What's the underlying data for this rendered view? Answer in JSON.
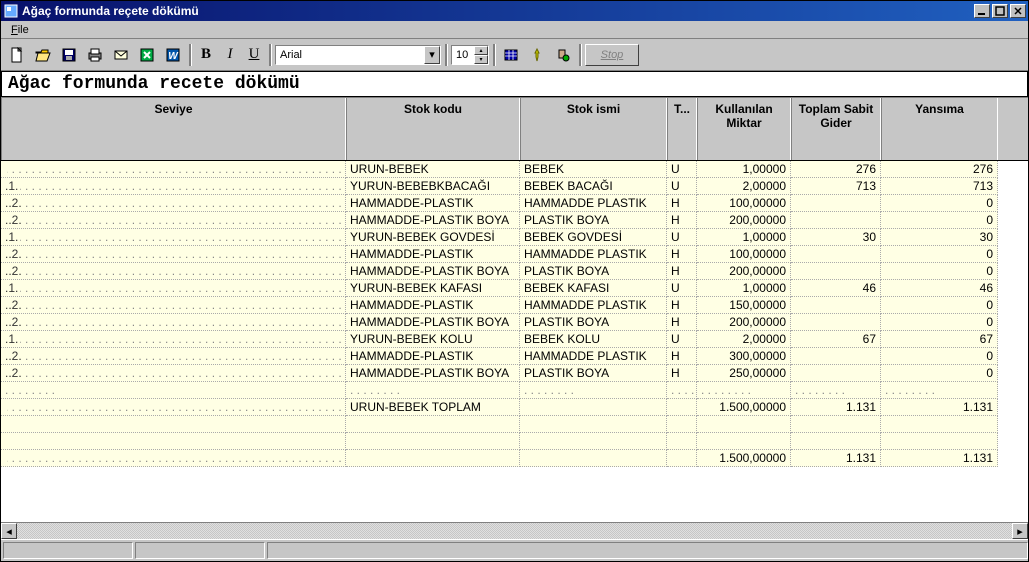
{
  "window": {
    "title": "Ağaç formunda reçete dökümü"
  },
  "menu": {
    "file": "File"
  },
  "toolbar": {
    "font_name": "Arial",
    "font_size": "10",
    "stop_label": "Stop"
  },
  "report": {
    "title": "Ağac formunda recete dökümü"
  },
  "columns": {
    "seviye": "Seviye",
    "stok_kodu": "Stok kodu",
    "stok_ismi": "Stok ismi",
    "t": "T...",
    "miktar": "Kullanılan Miktar",
    "gider": "Toplam Sabit Gider",
    "yansima": "Yansıma"
  },
  "rows": [
    {
      "sev": "",
      "kod": "URUN-BEBEK",
      "ism": "BEBEK",
      "t": "U",
      "mik": "1,00000",
      "gid": "276",
      "yan": "276"
    },
    {
      "sev": ".1.",
      "kod": "YURUN-BEBEBKBACAĞI",
      "ism": "BEBEK BACAĞI",
      "t": "U",
      "mik": "2,00000",
      "gid": "713",
      "yan": "713"
    },
    {
      "sev": "..2.",
      "kod": "HAMMADDE-PLASTIK",
      "ism": "HAMMADDE PLASTIK",
      "t": "H",
      "mik": "100,00000",
      "gid": "",
      "yan": "0"
    },
    {
      "sev": "..2.",
      "kod": "HAMMADDE-PLASTIK BOYA",
      "ism": "PLASTIK BOYA",
      "t": "H",
      "mik": "200,00000",
      "gid": "",
      "yan": "0"
    },
    {
      "sev": ".1.",
      "kod": "YURUN-BEBEK GOVDESİ",
      "ism": "BEBEK GOVDESİ",
      "t": "U",
      "mik": "1,00000",
      "gid": "30",
      "yan": "30"
    },
    {
      "sev": "..2.",
      "kod": "HAMMADDE-PLASTIK",
      "ism": "HAMMADDE PLASTIK",
      "t": "H",
      "mik": "100,00000",
      "gid": "",
      "yan": "0"
    },
    {
      "sev": "..2.",
      "kod": "HAMMADDE-PLASTIK BOYA",
      "ism": "PLASTIK BOYA",
      "t": "H",
      "mik": "200,00000",
      "gid": "",
      "yan": "0"
    },
    {
      "sev": ".1.",
      "kod": "YURUN-BEBEK KAFASI",
      "ism": "BEBEK KAFASI",
      "t": "U",
      "mik": "1,00000",
      "gid": "46",
      "yan": "46"
    },
    {
      "sev": "..2.",
      "kod": "HAMMADDE-PLASTIK",
      "ism": "HAMMADDE PLASTIK",
      "t": "H",
      "mik": "150,00000",
      "gid": "",
      "yan": "0"
    },
    {
      "sev": "..2.",
      "kod": "HAMMADDE-PLASTIK BOYA",
      "ism": "PLASTIK BOYA",
      "t": "H",
      "mik": "200,00000",
      "gid": "",
      "yan": "0"
    },
    {
      "sev": ".1.",
      "kod": "YURUN-BEBEK KOLU",
      "ism": "BEBEK KOLU",
      "t": "U",
      "mik": "2,00000",
      "gid": "67",
      "yan": "67"
    },
    {
      "sev": "..2.",
      "kod": "HAMMADDE-PLASTIK",
      "ism": "HAMMADDE PLASTIK",
      "t": "H",
      "mik": "300,00000",
      "gid": "",
      "yan": "0"
    },
    {
      "sev": "..2.",
      "kod": "HAMMADDE-PLASTIK BOYA",
      "ism": "PLASTIK BOYA",
      "t": "H",
      "mik": "250,00000",
      "gid": "",
      "yan": "0"
    },
    {
      "sev": "",
      "kod": "",
      "ism": "",
      "t": "",
      "mik": "",
      "gid": "",
      "yan": "",
      "dotrow": true
    },
    {
      "sev": "",
      "kod": "URUN-BEBEK TOPLAM",
      "ism": "",
      "t": "",
      "mik": "1.500,00000",
      "gid": "1.131",
      "yan": "1.131"
    },
    {
      "sev": "",
      "kod": "",
      "ism": "",
      "t": "",
      "mik": "",
      "gid": "",
      "yan": "",
      "blank": true
    },
    {
      "sev": "",
      "kod": "",
      "ism": "",
      "t": "",
      "mik": "",
      "gid": "",
      "yan": "",
      "blank": true
    },
    {
      "sev": "",
      "kod": "",
      "ism": "",
      "t": "",
      "mik": "1.500,00000",
      "gid": "1.131",
      "yan": "1.131"
    }
  ]
}
